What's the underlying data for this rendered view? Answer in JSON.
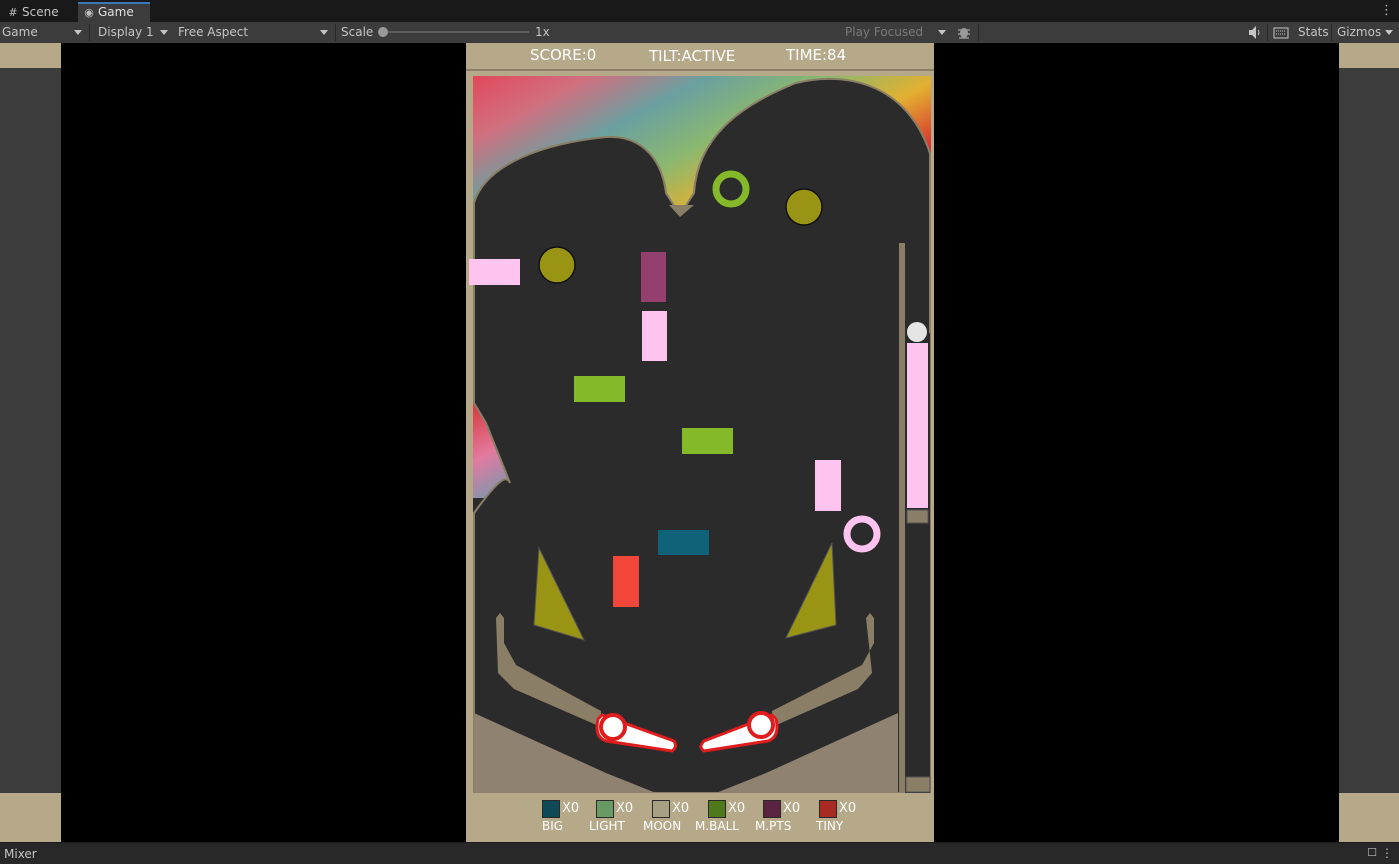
{
  "tabs": [
    {
      "label": "Scene",
      "icon": "grid-icon"
    },
    {
      "label": "Game",
      "icon": "gamepad-icon"
    }
  ],
  "toolbar": {
    "mode": "Game",
    "display": "Display 1",
    "aspect": "Free Aspect",
    "scale_label": "Scale",
    "scale_value": "1x",
    "play_mode": "Play Focused",
    "stats": "Stats",
    "gizmos": "Gizmos"
  },
  "hud": {
    "score": "SCORE:0",
    "tilt": "TILT:ACTIVE",
    "time": "TIME:84"
  },
  "powerups": [
    {
      "label": "BIG",
      "count": "X0",
      "color": "#0e4a56"
    },
    {
      "label": "LIGHT",
      "count": "X0",
      "color": "#6a9a64"
    },
    {
      "label": "MOON",
      "count": "X0",
      "color": "#a8a082"
    },
    {
      "label": "M.BALL",
      "count": "X0",
      "color": "#4e7a1c"
    },
    {
      "label": "M.PTS",
      "count": "X0",
      "color": "#5a2440"
    },
    {
      "label": "TINY",
      "count": "X0",
      "color": "#a82a20"
    }
  ],
  "bottom_panel": {
    "title": "Mixer"
  },
  "colors": {
    "frame": "#b6a98a",
    "playfield": "#2b2b2b",
    "bumper": "#9a9414",
    "pink": "#ffc3f0",
    "green": "#84ba2a",
    "teal": "#0f6278",
    "red": "#f2463a",
    "purple": "#94406e"
  }
}
